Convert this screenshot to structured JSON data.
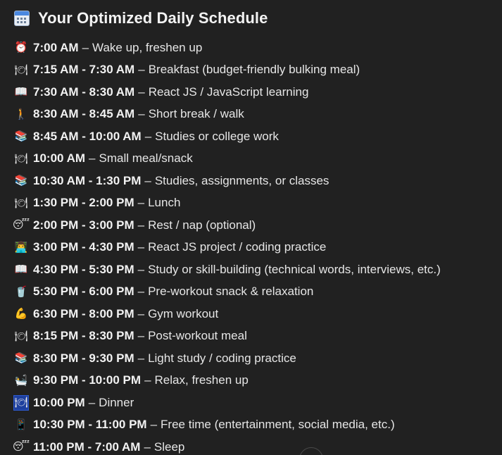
{
  "title": {
    "icon": "calendar-icon",
    "text": "Your Optimized Daily Schedule"
  },
  "schedule": [
    {
      "icon": "⏰",
      "icon_name": "alarm-clock-icon",
      "time": "7:00 AM",
      "desc": "Wake up, freshen up"
    },
    {
      "icon": "🍽",
      "icon_name": "plate-icon",
      "time": "7:15 AM - 7:30 AM",
      "desc": "Breakfast (budget-friendly bulking meal)"
    },
    {
      "icon": "📖",
      "icon_name": "open-book-icon",
      "time": "7:30 AM - 8:30 AM",
      "desc": "React JS / JavaScript learning"
    },
    {
      "icon": "🚶",
      "icon_name": "walking-person-icon",
      "time": "8:30 AM - 8:45 AM",
      "desc": "Short break / walk"
    },
    {
      "icon": "📚",
      "icon_name": "books-icon",
      "time": "8:45 AM - 10:00 AM",
      "desc": "Studies or college work"
    },
    {
      "icon": "🍽",
      "icon_name": "plate-icon",
      "time": "10:00 AM",
      "desc": "Small meal/snack"
    },
    {
      "icon": "📚",
      "icon_name": "books-icon",
      "time": "10:30 AM - 1:30 PM",
      "desc": "Studies, assignments, or classes"
    },
    {
      "icon": "🍽",
      "icon_name": "plate-icon",
      "time": "1:30 PM - 2:00 PM",
      "desc": "Lunch"
    },
    {
      "icon": "😴",
      "icon_name": "sleeping-face-icon",
      "time": "2:00 PM - 3:00 PM",
      "desc": "Rest / nap (optional)"
    },
    {
      "icon": "👨‍💻",
      "icon_name": "technologist-icon",
      "time": "3:00 PM - 4:30 PM",
      "desc": "React JS project / coding practice"
    },
    {
      "icon": "📖",
      "icon_name": "open-book-icon",
      "time": "4:30 PM - 5:30 PM",
      "desc": "Study or skill-building (technical words, interviews, etc.)"
    },
    {
      "icon": "🥤",
      "icon_name": "cup-with-straw-icon",
      "time": "5:30 PM - 6:00 PM",
      "desc": "Pre-workout snack & relaxation"
    },
    {
      "icon": "💪",
      "icon_name": "flexed-biceps-icon",
      "time": "6:30 PM - 8:00 PM",
      "desc": "Gym workout"
    },
    {
      "icon": "🍽",
      "icon_name": "plate-icon",
      "time": "8:15 PM - 8:30 PM",
      "desc": "Post-workout meal"
    },
    {
      "icon": "📚",
      "icon_name": "books-icon",
      "time": "8:30 PM - 9:30 PM",
      "desc": "Light study / coding practice"
    },
    {
      "icon": "🛀",
      "icon_name": "bath-icon",
      "time": "9:30 PM - 10:00 PM",
      "desc": "Relax, freshen up"
    },
    {
      "icon": "🍽",
      "icon_name": "plate-icon",
      "time": "10:00 PM",
      "desc": "Dinner"
    },
    {
      "icon": "📱",
      "icon_name": "mobile-phone-icon",
      "time": "10:30 PM - 11:00 PM",
      "desc": "Free time (entertainment, social media, etc.)"
    },
    {
      "icon": "😴",
      "icon_name": "sleeping-face-icon",
      "time": "11:00 PM - 7:00 AM",
      "desc": "Sleep"
    }
  ],
  "separator": "–",
  "colors": {
    "background": "#212121",
    "text": "#ececec",
    "selection": "#1d3f9e"
  }
}
